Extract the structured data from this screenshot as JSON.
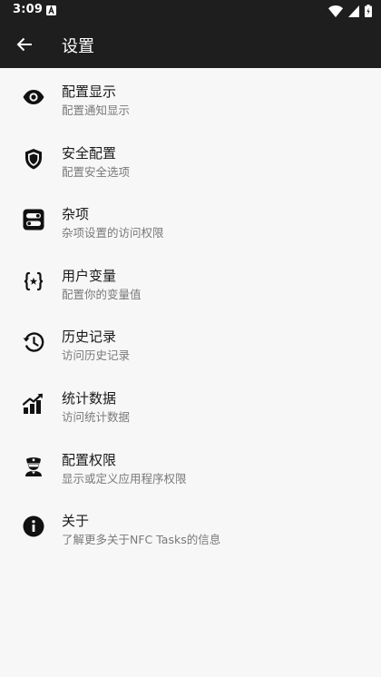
{
  "status_bar": {
    "time": "3:09",
    "notification_icon": "a-box-icon",
    "system_icons": [
      "wifi-icon",
      "signal-icon",
      "battery-icon"
    ]
  },
  "app_bar": {
    "back_icon": "arrow-left-icon",
    "title": "设置"
  },
  "settings": [
    {
      "icon": "eye-icon",
      "title": "配置显示",
      "subtitle": "配置通知显示"
    },
    {
      "icon": "shield-icon",
      "title": "安全配置",
      "subtitle": "配置安全选项"
    },
    {
      "icon": "toggles-icon",
      "title": "杂项",
      "subtitle": "杂项设置的访问权限"
    },
    {
      "icon": "variable-icon",
      "title": "用户变量",
      "subtitle": "配置你的变量值"
    },
    {
      "icon": "history-icon",
      "title": "历史记录",
      "subtitle": "访问历史记录"
    },
    {
      "icon": "chart-icon",
      "title": "统计数据",
      "subtitle": "访问统计数据"
    },
    {
      "icon": "police-icon",
      "title": "配置权限",
      "subtitle": "显示或定义应用程序权限"
    },
    {
      "icon": "info-icon",
      "title": "关于",
      "subtitle": "了解更多关于NFC Tasks的信息"
    }
  ],
  "colors": {
    "bar_background": "#1e1e1e",
    "page_background": "#f7f7f8",
    "primary_text": "#1a1a1a",
    "secondary_text": "#7a7a7a"
  }
}
